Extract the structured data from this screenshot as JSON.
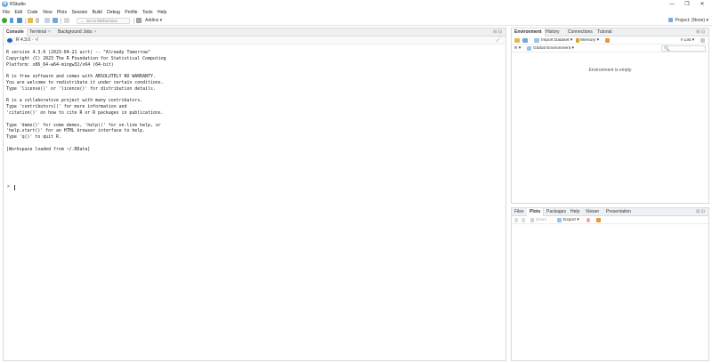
{
  "window": {
    "title": "RStudio",
    "logo_letter": "R",
    "controls": {
      "minimize": "—",
      "maximize": "❐",
      "close": "✕"
    }
  },
  "menu": [
    "File",
    "Edit",
    "Code",
    "View",
    "Plots",
    "Session",
    "Build",
    "Debug",
    "Profile",
    "Tools",
    "Help"
  ],
  "toolbar": {
    "goto_placeholder": "Go to file/function",
    "goto_icon": "→",
    "addins_label": "Addins ▾",
    "project_label": "Project: (None) ▾"
  },
  "console_pane": {
    "tabs": [
      {
        "label": "Console",
        "close": ""
      },
      {
        "label": "Terminal",
        "close": "×"
      },
      {
        "label": "Background Jobs",
        "close": "×"
      }
    ],
    "pane_controls": "⊟ ⊡",
    "version_path": "R 4.3.0 · ~/",
    "clear_icon": "🖌",
    "output_lines": [
      "R version 4.3.0 (2023-04-21 ucrt) -- \"Already Tomorrow\"",
      "Copyright (C) 2023 The R Foundation for Statistical Computing",
      "Platform: x86_64-w64-mingw32/x64 (64-bit)",
      "",
      "R is free software and comes with ABSOLUTELY NO WARRANTY.",
      "You are welcome to redistribute it under certain conditions.",
      "Type 'license()' or 'licence()' for distribution details.",
      "",
      "R is a collaborative project with many contributors.",
      "Type 'contributors()' for more information and",
      "'citation()' on how to cite R or R packages in publications.",
      "",
      "Type 'demo()' for some demos, 'help()' for on-line help, or",
      "'help.start()' for an HTML browser interface to help.",
      "Type 'q()' to quit R.",
      "",
      "[Workspace loaded from ~/.RData]"
    ],
    "prompt": ">"
  },
  "env_pane": {
    "tabs": [
      "Environment",
      "History",
      "Connections",
      "Tutorial"
    ],
    "pane_controls": "⊟ ⊡",
    "import_label": "Import Dataset ▾",
    "memory_label": "Memory ▾",
    "list_label": "≡ List ▾",
    "lang_label": "R ▾",
    "scope_label": "Global Environment ▾",
    "search_icon": "🔍",
    "empty_message": "Environment is empty"
  },
  "files_pane": {
    "tabs": [
      "Files",
      "Plots",
      "Packages",
      "Help",
      "Viewer",
      "Presentation"
    ],
    "pane_controls": "⊟ ⊡",
    "zoom_label": "Zoom",
    "export_label": "Export ▾"
  },
  "colors": {
    "rstudio_blue": "#75aadb",
    "r_logo_blue": "#1f65b7",
    "prompt_blue": "#1c3fa8",
    "tab_bg": "#eef1f4"
  }
}
